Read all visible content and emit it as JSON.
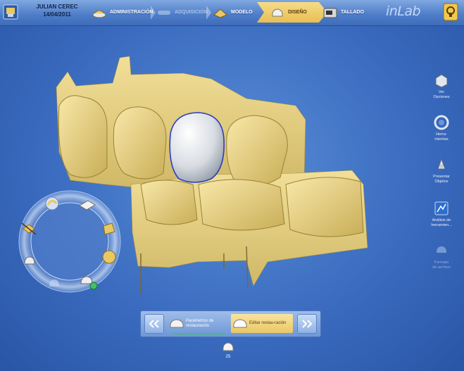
{
  "patient": {
    "name": "JULIAN CEREC",
    "date": "14/04/2011"
  },
  "steps": [
    {
      "label": "ADMINISTRACIÓN",
      "state": "normal"
    },
    {
      "label": "ADQUISICIÓN",
      "state": "disabled"
    },
    {
      "label": "MODELO",
      "state": "normal"
    },
    {
      "label": "DISEÑO",
      "state": "active"
    },
    {
      "label": "TALLADO",
      "state": "normal"
    }
  ],
  "brand": "inLab",
  "right_tools": [
    {
      "label": "Ver\nOpciones",
      "icon": "view-options-icon"
    },
    {
      "label": "Herra-\nmientas",
      "icon": "tools-ring-icon"
    },
    {
      "label": "Presentar\nObjetos",
      "icon": "present-objects-icon"
    },
    {
      "label": "Análisis de\nherramien...",
      "icon": "analysis-icon"
    },
    {
      "label": "Formato\nde archivo",
      "icon": "file-format-icon"
    }
  ],
  "bottom_nav": {
    "items": [
      {
        "label": "Parámetros de restauración"
      },
      {
        "label": "Editar restau-ración"
      }
    ]
  },
  "tooth_tab": {
    "number": "25"
  },
  "colors": {
    "accent": "#e8bf52",
    "model": "#e8d48a",
    "crown": "#d9dde2",
    "background": "#3b6cc0"
  }
}
